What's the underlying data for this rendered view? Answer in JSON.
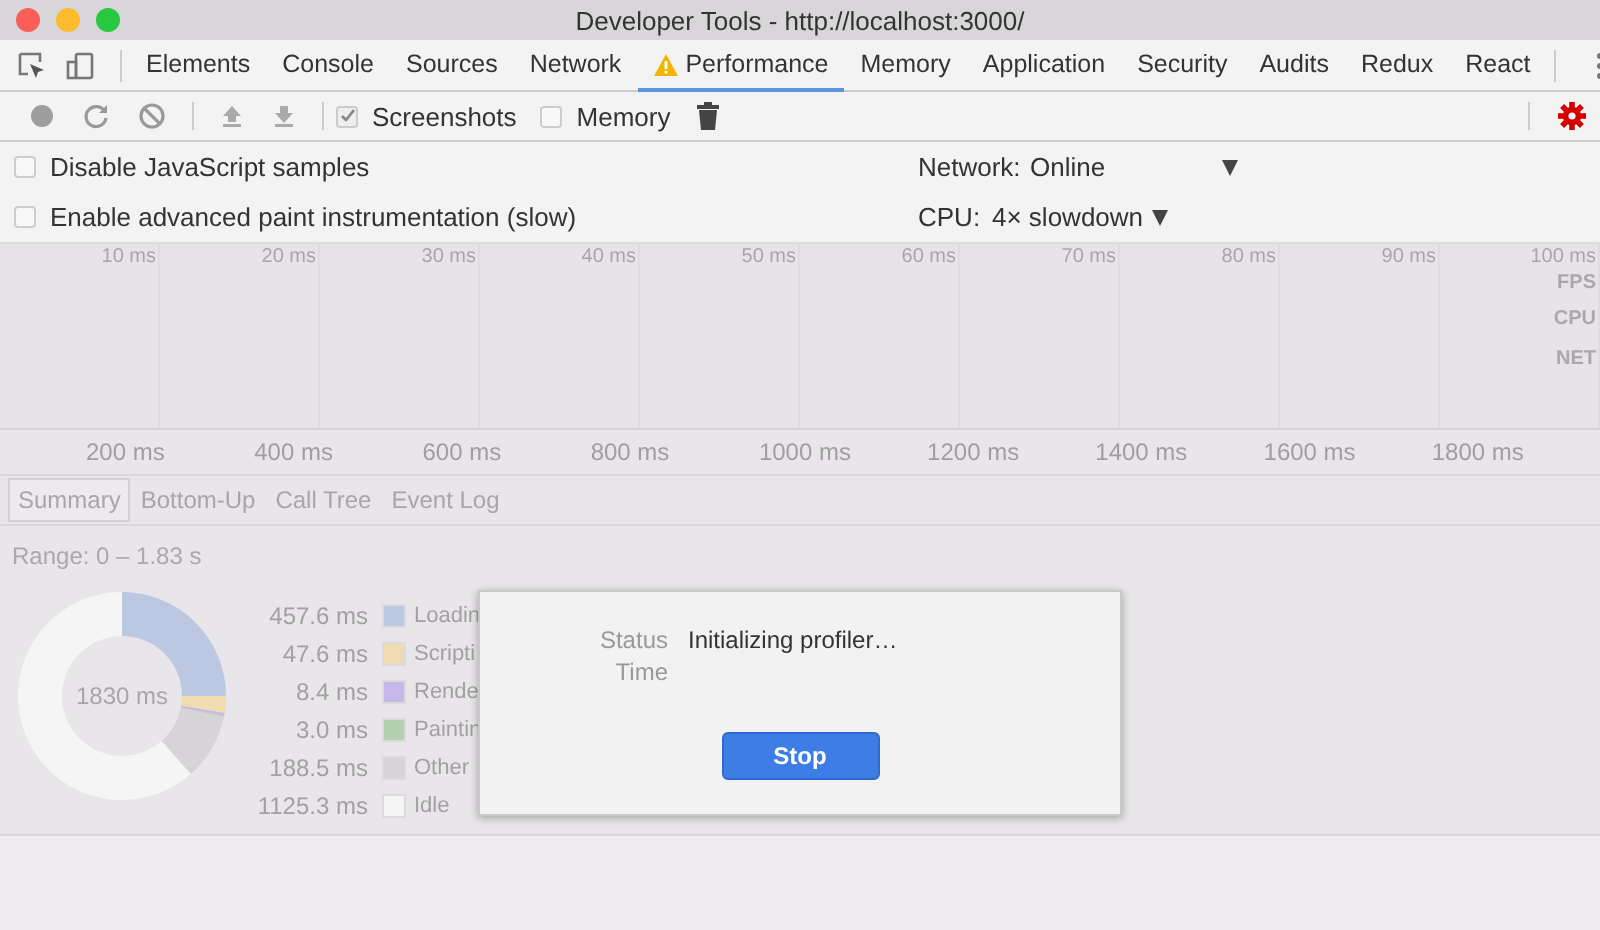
{
  "window": {
    "title": "Developer Tools - http://localhost:3000/"
  },
  "tabs": [
    {
      "label": "Elements",
      "selected": false
    },
    {
      "label": "Console",
      "selected": false
    },
    {
      "label": "Sources",
      "selected": false
    },
    {
      "label": "Network",
      "selected": false
    },
    {
      "label": "Performance",
      "selected": true,
      "warning": true
    },
    {
      "label": "Memory",
      "selected": false
    },
    {
      "label": "Application",
      "selected": false
    },
    {
      "label": "Security",
      "selected": false
    },
    {
      "label": "Audits",
      "selected": false
    },
    {
      "label": "Redux",
      "selected": false
    },
    {
      "label": "React",
      "selected": false
    }
  ],
  "capture_options": [
    {
      "label": "Screenshots",
      "checked": true
    },
    {
      "label": "Memory",
      "checked": false
    }
  ],
  "settings": {
    "checkboxes": [
      {
        "label": "Disable JavaScript samples",
        "checked": false
      },
      {
        "label": "Enable advanced paint instrumentation (slow)",
        "checked": false
      }
    ],
    "network": {
      "label": "Network:",
      "value": "Online"
    },
    "cpu": {
      "label": "CPU:",
      "value": "4× slowdown"
    }
  },
  "overview": {
    "ticks": [
      "10 ms",
      "20 ms",
      "30 ms",
      "40 ms",
      "50 ms",
      "60 ms",
      "70 ms",
      "80 ms",
      "90 ms",
      "100 ms"
    ],
    "tracks": [
      "FPS",
      "CPU",
      "NET"
    ],
    "ruler": [
      "200 ms",
      "400 ms",
      "600 ms",
      "800 ms",
      "1000 ms",
      "1200 ms",
      "1400 ms",
      "1600 ms",
      "1800 ms"
    ]
  },
  "detail_tabs": [
    {
      "label": "Summary",
      "selected": true
    },
    {
      "label": "Bottom-Up",
      "selected": false
    },
    {
      "label": "Call Tree",
      "selected": false
    },
    {
      "label": "Event Log",
      "selected": false
    }
  ],
  "summary": {
    "range": "Range: 0 – 1.83 s",
    "total": "1830 ms",
    "items": [
      {
        "value": "457.6 ms",
        "label": "Loadin",
        "color": "#bcc7e2"
      },
      {
        "value": "47.6 ms",
        "label": "Scripti",
        "color": "#f0dcb0"
      },
      {
        "value": "8.4 ms",
        "label": "Rende",
        "color": "#c6b8ea"
      },
      {
        "value": "3.0 ms",
        "label": "Paintin",
        "color": "#b4d2b0"
      },
      {
        "value": "188.5 ms",
        "label": "Other",
        "color": "#d6d4d6"
      },
      {
        "value": "1125.3 ms",
        "label": "Idle",
        "color": "#f6f5f6"
      }
    ]
  },
  "dialog": {
    "rows": [
      {
        "label": "Status",
        "value": "Initializing profiler…"
      },
      {
        "label": "Time"
      }
    ],
    "button": "Stop"
  }
}
